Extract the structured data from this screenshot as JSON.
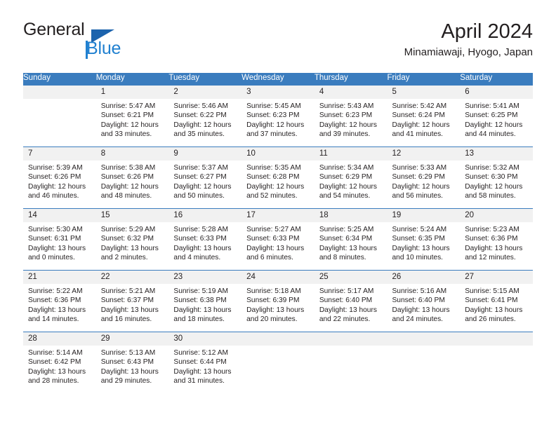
{
  "brand": {
    "name_part1": "General",
    "name_part2": "Blue",
    "color_dark": "#231f20",
    "color_blue": "#2080d0",
    "triangle_color": "#1c63ad"
  },
  "header": {
    "title": "April 2024",
    "subtitle": "Minamiawaji, Hyogo, Japan"
  },
  "calendar": {
    "accent_color": "#3a7cbe",
    "daynum_band_color": "#f1f1f1",
    "weekday_headers": [
      "Sunday",
      "Monday",
      "Tuesday",
      "Wednesday",
      "Thursday",
      "Friday",
      "Saturday"
    ],
    "weeks": [
      [
        {
          "day": "",
          "details": ""
        },
        {
          "day": "1",
          "details": "Sunrise: 5:47 AM\nSunset: 6:21 PM\nDaylight: 12 hours\nand 33 minutes."
        },
        {
          "day": "2",
          "details": "Sunrise: 5:46 AM\nSunset: 6:22 PM\nDaylight: 12 hours\nand 35 minutes."
        },
        {
          "day": "3",
          "details": "Sunrise: 5:45 AM\nSunset: 6:23 PM\nDaylight: 12 hours\nand 37 minutes."
        },
        {
          "day": "4",
          "details": "Sunrise: 5:43 AM\nSunset: 6:23 PM\nDaylight: 12 hours\nand 39 minutes."
        },
        {
          "day": "5",
          "details": "Sunrise: 5:42 AM\nSunset: 6:24 PM\nDaylight: 12 hours\nand 41 minutes."
        },
        {
          "day": "6",
          "details": "Sunrise: 5:41 AM\nSunset: 6:25 PM\nDaylight: 12 hours\nand 44 minutes."
        }
      ],
      [
        {
          "day": "7",
          "details": "Sunrise: 5:39 AM\nSunset: 6:26 PM\nDaylight: 12 hours\nand 46 minutes."
        },
        {
          "day": "8",
          "details": "Sunrise: 5:38 AM\nSunset: 6:26 PM\nDaylight: 12 hours\nand 48 minutes."
        },
        {
          "day": "9",
          "details": "Sunrise: 5:37 AM\nSunset: 6:27 PM\nDaylight: 12 hours\nand 50 minutes."
        },
        {
          "day": "10",
          "details": "Sunrise: 5:35 AM\nSunset: 6:28 PM\nDaylight: 12 hours\nand 52 minutes."
        },
        {
          "day": "11",
          "details": "Sunrise: 5:34 AM\nSunset: 6:29 PM\nDaylight: 12 hours\nand 54 minutes."
        },
        {
          "day": "12",
          "details": "Sunrise: 5:33 AM\nSunset: 6:29 PM\nDaylight: 12 hours\nand 56 minutes."
        },
        {
          "day": "13",
          "details": "Sunrise: 5:32 AM\nSunset: 6:30 PM\nDaylight: 12 hours\nand 58 minutes."
        }
      ],
      [
        {
          "day": "14",
          "details": "Sunrise: 5:30 AM\nSunset: 6:31 PM\nDaylight: 13 hours\nand 0 minutes."
        },
        {
          "day": "15",
          "details": "Sunrise: 5:29 AM\nSunset: 6:32 PM\nDaylight: 13 hours\nand 2 minutes."
        },
        {
          "day": "16",
          "details": "Sunrise: 5:28 AM\nSunset: 6:33 PM\nDaylight: 13 hours\nand 4 minutes."
        },
        {
          "day": "17",
          "details": "Sunrise: 5:27 AM\nSunset: 6:33 PM\nDaylight: 13 hours\nand 6 minutes."
        },
        {
          "day": "18",
          "details": "Sunrise: 5:25 AM\nSunset: 6:34 PM\nDaylight: 13 hours\nand 8 minutes."
        },
        {
          "day": "19",
          "details": "Sunrise: 5:24 AM\nSunset: 6:35 PM\nDaylight: 13 hours\nand 10 minutes."
        },
        {
          "day": "20",
          "details": "Sunrise: 5:23 AM\nSunset: 6:36 PM\nDaylight: 13 hours\nand 12 minutes."
        }
      ],
      [
        {
          "day": "21",
          "details": "Sunrise: 5:22 AM\nSunset: 6:36 PM\nDaylight: 13 hours\nand 14 minutes."
        },
        {
          "day": "22",
          "details": "Sunrise: 5:21 AM\nSunset: 6:37 PM\nDaylight: 13 hours\nand 16 minutes."
        },
        {
          "day": "23",
          "details": "Sunrise: 5:19 AM\nSunset: 6:38 PM\nDaylight: 13 hours\nand 18 minutes."
        },
        {
          "day": "24",
          "details": "Sunrise: 5:18 AM\nSunset: 6:39 PM\nDaylight: 13 hours\nand 20 minutes."
        },
        {
          "day": "25",
          "details": "Sunrise: 5:17 AM\nSunset: 6:40 PM\nDaylight: 13 hours\nand 22 minutes."
        },
        {
          "day": "26",
          "details": "Sunrise: 5:16 AM\nSunset: 6:40 PM\nDaylight: 13 hours\nand 24 minutes."
        },
        {
          "day": "27",
          "details": "Sunrise: 5:15 AM\nSunset: 6:41 PM\nDaylight: 13 hours\nand 26 minutes."
        }
      ],
      [
        {
          "day": "28",
          "details": "Sunrise: 5:14 AM\nSunset: 6:42 PM\nDaylight: 13 hours\nand 28 minutes."
        },
        {
          "day": "29",
          "details": "Sunrise: 5:13 AM\nSunset: 6:43 PM\nDaylight: 13 hours\nand 29 minutes."
        },
        {
          "day": "30",
          "details": "Sunrise: 5:12 AM\nSunset: 6:44 PM\nDaylight: 13 hours\nand 31 minutes."
        },
        {
          "day": "",
          "details": ""
        },
        {
          "day": "",
          "details": ""
        },
        {
          "day": "",
          "details": ""
        },
        {
          "day": "",
          "details": ""
        }
      ]
    ]
  }
}
